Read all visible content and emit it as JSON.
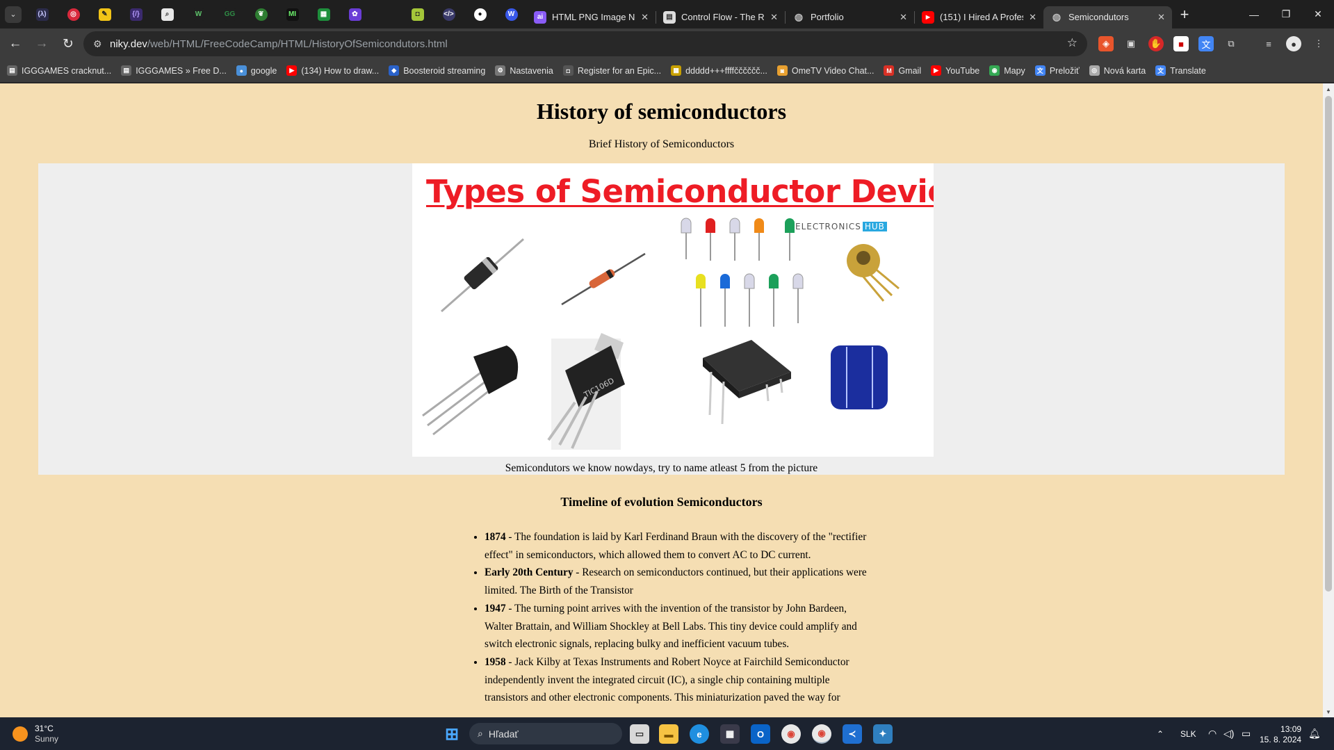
{
  "browser": {
    "tabs": [
      {
        "title": "HTML PNG Image No",
        "favicon": "ai-icon",
        "color": "#8a5cf6"
      },
      {
        "title": "Control Flow - The Ru",
        "favicon": "book-icon",
        "color": "#dddddd"
      },
      {
        "title": "Portfolio",
        "favicon": "globe-icon",
        "color": "#bbbbbb"
      },
      {
        "title": "(151) I Hired A Profes",
        "favicon": "youtube-icon",
        "color": "#ff0000"
      },
      {
        "title": "Semicondutors",
        "favicon": "globe-icon",
        "color": "#bbbbbb",
        "active": true
      }
    ],
    "address": {
      "host": "niky.dev",
      "path": "/web/HTML/FreeCodeCamp/HTML/HistoryOfSemicondutors.html"
    },
    "bookmarks": [
      {
        "label": "IGGGAMES cracknut...",
        "icon": "page-icon",
        "color": "#666666"
      },
      {
        "label": "IGGGAMES » Free D...",
        "icon": "page-icon",
        "color": "#666666"
      },
      {
        "label": "google",
        "icon": "people-icon",
        "color": "#4a90d9"
      },
      {
        "label": "(134) How to draw...",
        "icon": "youtube-icon",
        "color": "#ff0000"
      },
      {
        "label": "Boosteroid streaming",
        "icon": "boosteroid-icon",
        "color": "#2a62c9"
      },
      {
        "label": "Nastavenia",
        "icon": "gear-icon",
        "color": "#777777"
      },
      {
        "label": "Register for an Epic...",
        "icon": "epic-icon",
        "color": "#555555"
      },
      {
        "label": "ddddd+++ffffčččččč...",
        "icon": "sheet-icon",
        "color": "#c8a000"
      },
      {
        "label": "OmeTV Video Chat...",
        "icon": "ometv-icon",
        "color": "#e8a030"
      },
      {
        "label": "Gmail",
        "icon": "gmail-icon",
        "color": "#d93025"
      },
      {
        "label": "YouTube",
        "icon": "youtube-icon",
        "color": "#ff0000"
      },
      {
        "label": "Mapy",
        "icon": "maps-icon",
        "color": "#34a853"
      },
      {
        "label": "Preložiť",
        "icon": "translate-icon",
        "color": "#4285f4"
      },
      {
        "label": "Nová karta",
        "icon": "chrome-icon",
        "color": "#aaaaaa"
      },
      {
        "label": "Translate",
        "icon": "translate-icon",
        "color": "#4285f4"
      }
    ]
  },
  "page": {
    "title": "History of semiconductors",
    "subtitle": "Brief History of Semiconductors",
    "image_heading": "Types of Semiconductor Devices",
    "watermark_text": "ELECTRONICS",
    "watermark_hub": "HUB",
    "caption": "Semicondutors we know nowdays, try to name atleast 5 from the picture",
    "timeline_title": "Timeline of evolution Semiconductors",
    "timeline": [
      {
        "year": "1874",
        "text": " - The foundation is laid by Karl Ferdinand Braun with the discovery of the \"rectifier effect\" in semiconductors, which allowed them to convert AC to DC current."
      },
      {
        "year": "Early 20th Century",
        "text": " - Research on semiconductors continued, but their applications were limited. The Birth of the Transistor"
      },
      {
        "year": "1947",
        "text": " - The turning point arrives with the invention of the transistor by John Bardeen, Walter Brattain, and William Shockley at Bell Labs. This tiny device could amplify and switch electronic signals, replacing bulky and inefficient vacuum tubes."
      },
      {
        "year": "1958",
        "text": " - Jack Kilby at Texas Instruments and Robert Noyce at Fairchild Semiconductor independently invent the integrated circuit (IC), a single chip containing multiple transistors and other electronic components. This miniaturization paved the way for"
      }
    ]
  },
  "taskbar": {
    "temperature": "31°C",
    "condition": "Sunny",
    "search_placeholder": "Hľadať",
    "language": "SLK",
    "time": "13:09",
    "date": "15. 8. 2024"
  }
}
